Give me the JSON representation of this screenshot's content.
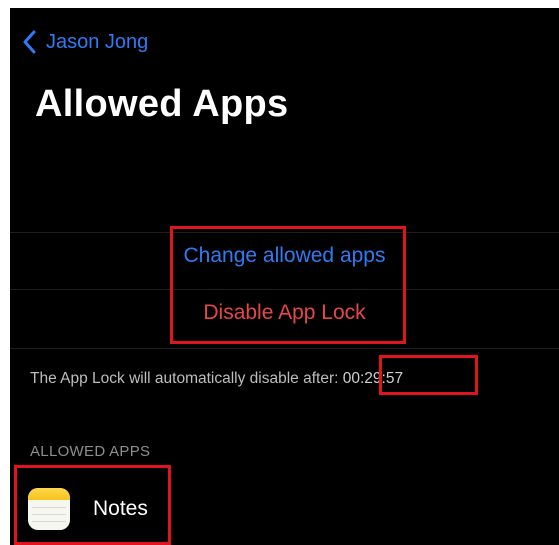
{
  "nav": {
    "back_label": "Jason Jong",
    "accent_color": "#2f7bf5"
  },
  "page": {
    "title": "Allowed Apps"
  },
  "actions": {
    "change_label": "Change allowed apps",
    "disable_label": "Disable App Lock",
    "change_color": "#2f7bf5",
    "disable_color": "#e5474a"
  },
  "footer": {
    "text": "The App Lock will automatically disable after: ",
    "timer": "00:29:57"
  },
  "allowed_section": {
    "header": "ALLOWED APPS",
    "apps": [
      {
        "name": "Notes",
        "icon": "notes-app-icon"
      }
    ]
  },
  "annotations": {
    "color": "#e0141e"
  }
}
